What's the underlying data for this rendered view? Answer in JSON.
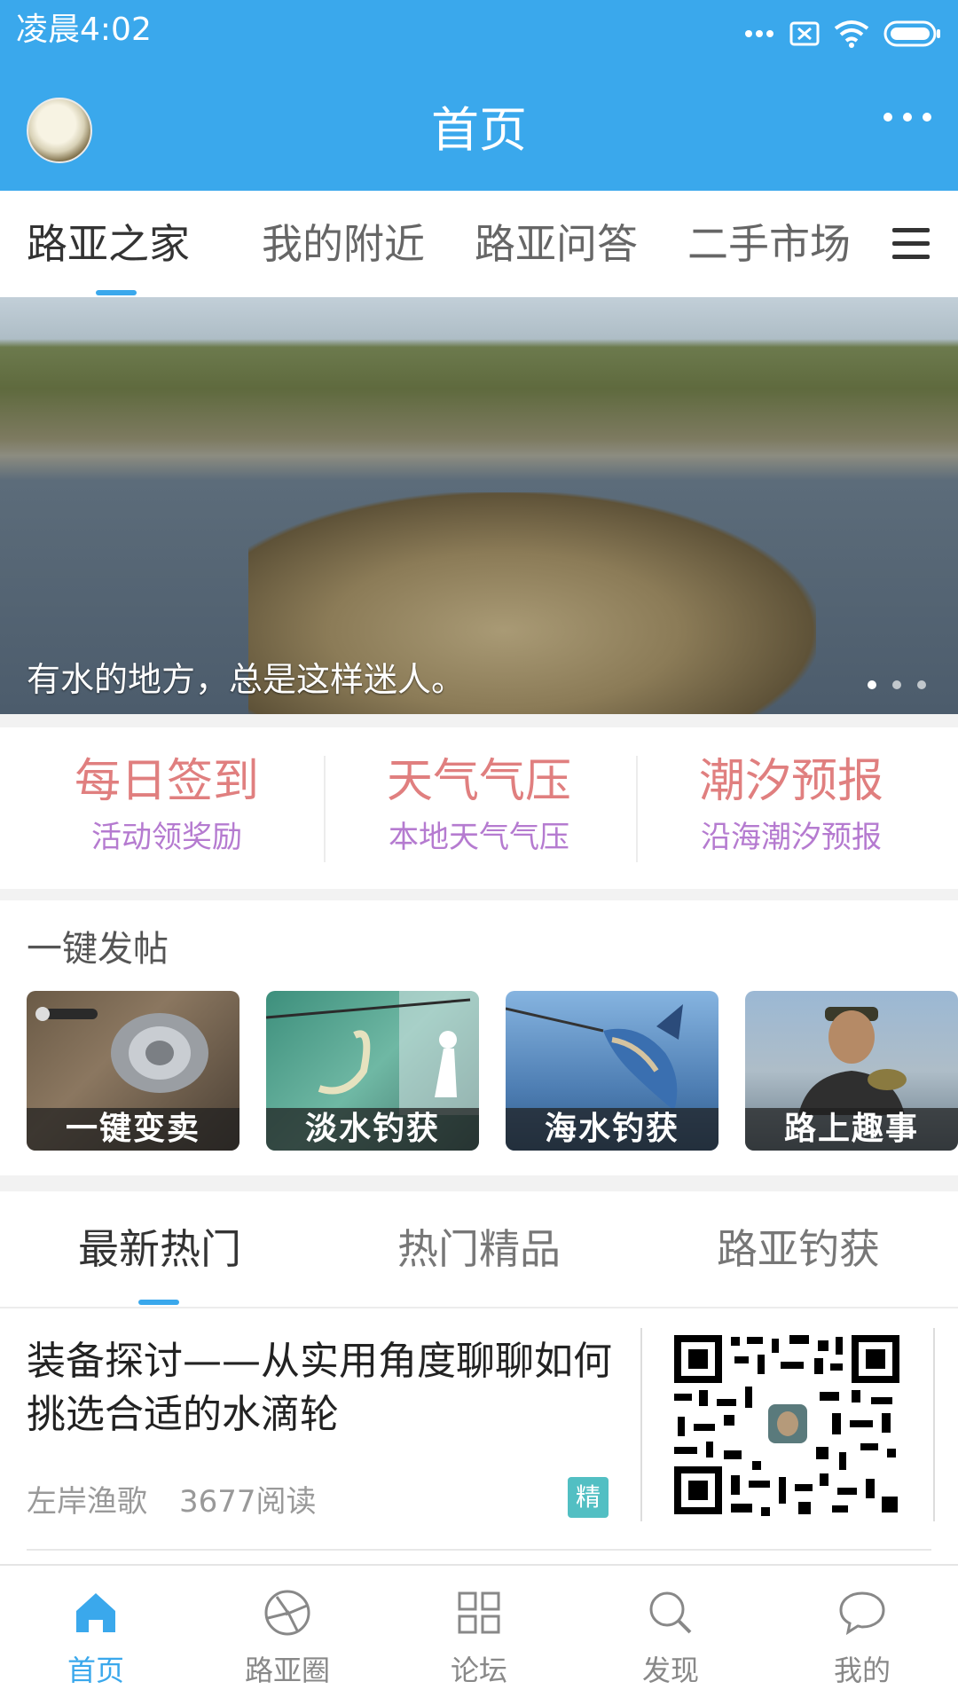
{
  "status": {
    "time": "凌晨4:02"
  },
  "appbar": {
    "title": "首页"
  },
  "category_tabs": [
    "路亚之家",
    "我的附近",
    "路亚问答",
    "二手市场"
  ],
  "banner": {
    "caption": "有水的地方，总是这样迷人。",
    "active_index": 0,
    "count": 3
  },
  "quick_actions": [
    {
      "title": "每日签到",
      "subtitle": "活动领奖励"
    },
    {
      "title": "天气气压",
      "subtitle": "本地天气气压"
    },
    {
      "title": "潮汐预报",
      "subtitle": "沿海潮汐预报"
    }
  ],
  "post_section": {
    "label": "一键发帖",
    "cards": [
      "一键变卖",
      "淡水钓获",
      "海水钓获",
      "路上趣事"
    ]
  },
  "hot_tabs": [
    "最新热门",
    "热门精品",
    "路亚钓获"
  ],
  "article": {
    "title": "装备探讨——从实用角度聊聊如何挑选合适的水滴轮",
    "author": "左岸渔歌",
    "reads": "3677阅读",
    "badge": "精"
  },
  "bottom_nav": [
    "首页",
    "路亚圈",
    "论坛",
    "发现",
    "我的"
  ],
  "colors": {
    "primary": "#3aa8ec",
    "quick_title": "#e07f7f",
    "quick_sub": "#b57bd0",
    "badge": "#52bfc3"
  }
}
